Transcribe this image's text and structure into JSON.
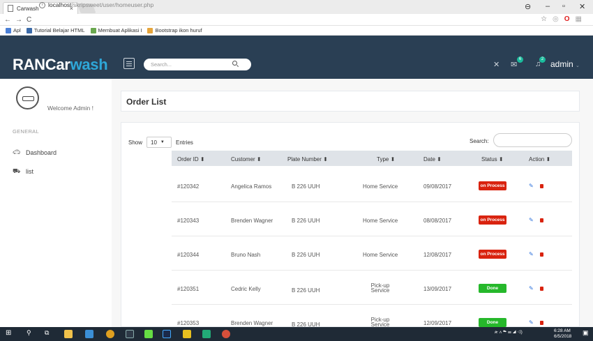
{
  "browser": {
    "tab_title": "Carwash",
    "tab_close": "×",
    "url_host": "localhost",
    "url_path": "/skripsweet/user/homeuser.php",
    "bookmarks": [
      "Apl",
      "Tutorial Belajar HTML",
      "Membuat Aplikasi I",
      "Bootstrap ikon huruf"
    ]
  },
  "header": {
    "brand_main": "RANCar",
    "brand_accent": "wash",
    "search_placeholder": "Search...",
    "mail_badge": "6",
    "bell_badge": "2",
    "user": "admin"
  },
  "sidebar": {
    "welcome": "Welcome Admin !",
    "section": "GENERAL",
    "items": [
      {
        "label": "Dashboard",
        "icon": "car-icon"
      },
      {
        "label": "list",
        "icon": "cart-icon"
      }
    ]
  },
  "main": {
    "title": "Order List",
    "show_label": "Show",
    "entries_value": "10",
    "entries_label": "Entries",
    "search_label": "Search:",
    "columns": [
      "Order ID",
      "Customer",
      "Plate Number",
      "Type",
      "Date",
      "Status",
      "Action"
    ],
    "rows": [
      {
        "id": "#120342",
        "customer": "Angelica Ramos",
        "plate": "B 226 UUH",
        "type": "Home Service",
        "date": "09/08/2017",
        "status": "on Process"
      },
      {
        "id": "#120343",
        "customer": "Brenden Wagner",
        "plate": "B 226 UUH",
        "type": "Home Service",
        "date": "08/08/2017",
        "status": "on Process"
      },
      {
        "id": "#120344",
        "customer": "Bruno Nash",
        "plate": "B 226 UUH",
        "type": "Home Service",
        "date": "12/08/2017",
        "status": "on Process"
      },
      {
        "id": "#120351",
        "customer": "Cedric Kelly",
        "plate": "B 226 UUH",
        "type": "Pick-up Service",
        "date": "13/09/2017",
        "status": "Done"
      },
      {
        "id": "#120353",
        "customer": "Brenden Wagner",
        "plate": "B 226 UUH",
        "type": "Pick-up Service",
        "date": "12/09/2017",
        "status": "Done"
      }
    ]
  },
  "taskbar": {
    "time": "6:28 AM",
    "date": "6/5/2018"
  },
  "colors": {
    "header": "#2a3f54",
    "brand_accent": "#2ea7d8",
    "status_process": "#d9230f",
    "status_done": "#26b82b"
  }
}
